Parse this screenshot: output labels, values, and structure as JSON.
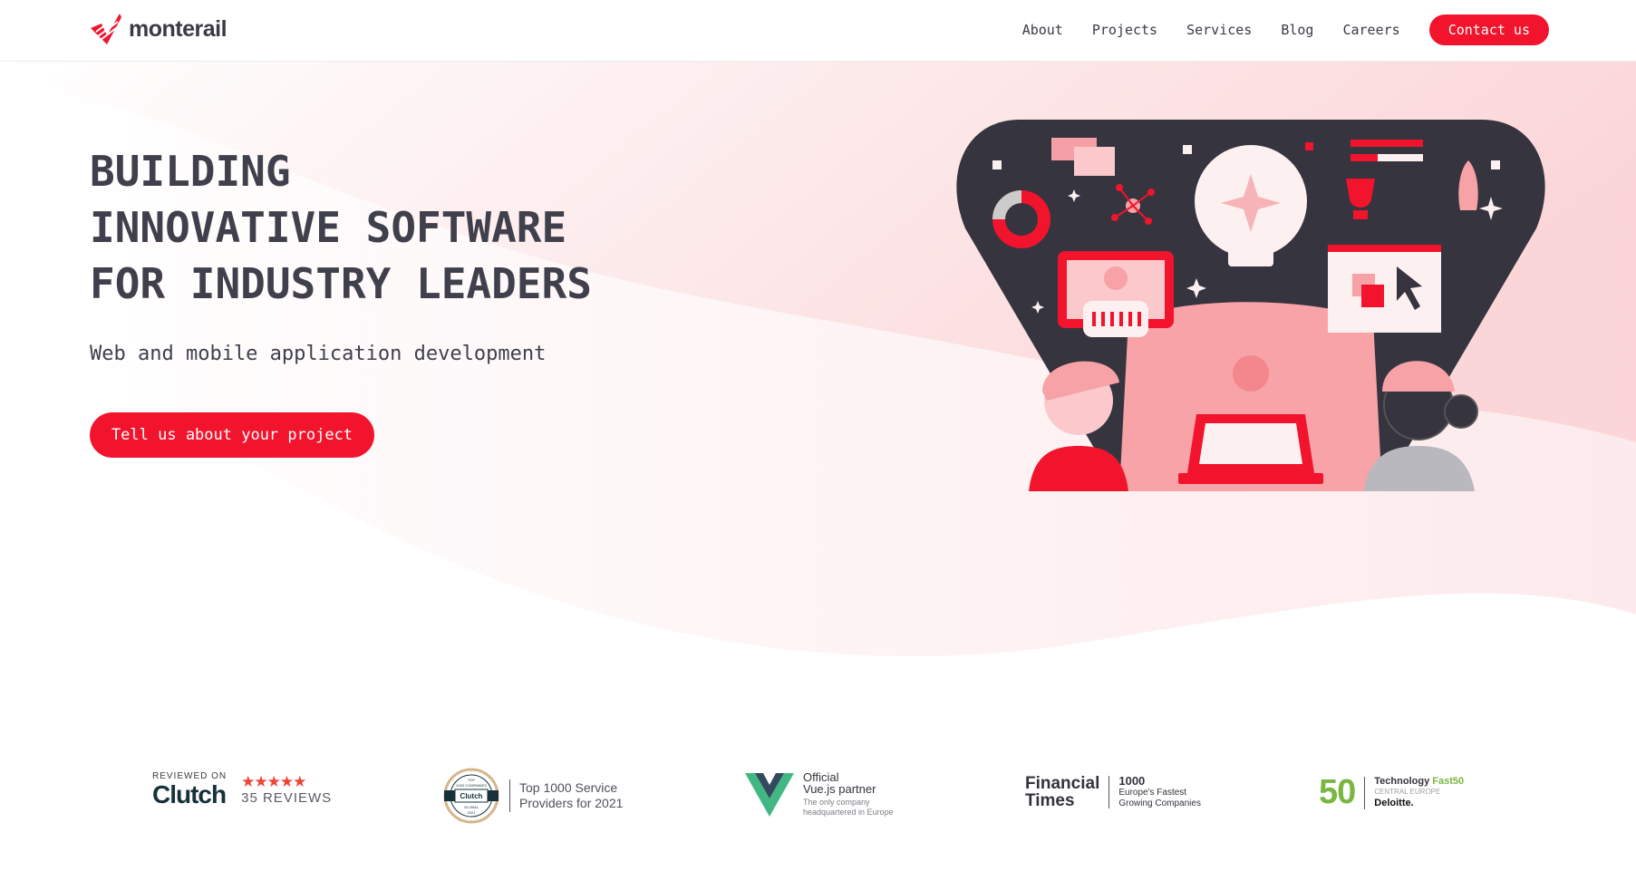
{
  "brand": {
    "name": "monterail",
    "accent": "#f1142c",
    "text_color": "#40404c"
  },
  "nav": {
    "links": [
      "About",
      "Projects",
      "Services",
      "Blog",
      "Careers"
    ],
    "contact_label": "Contact us"
  },
  "hero": {
    "title_lines": [
      "BUILDING",
      "INNOVATIVE SOFTWARE",
      "FOR INDUSTRY LEADERS"
    ],
    "subtitle": "Web and mobile application development",
    "cta_label": "Tell us about your project",
    "illustration": "team-building-software-illustration"
  },
  "badges": {
    "clutch": {
      "reviewed_on": "REVIEWED ON",
      "name": "Clutch",
      "rating_stars": 5,
      "reviews": "35 REVIEWS"
    },
    "clutch_top": {
      "seal_top": "TOP",
      "seal_mid": "1000 COMPANIES",
      "seal_brand": "Clutch",
      "seal_region": "GLOBAL",
      "seal_year": "2021",
      "line1": "Top 1000 Service",
      "line2": "Providers for 2021"
    },
    "vue": {
      "line1": "Official",
      "line2": "Vue.js partner",
      "sub1": "The only company",
      "sub2": "headquartered in Europe"
    },
    "ft": {
      "line1": "Financial",
      "line2": "Times",
      "number": "1000",
      "sub1": "Europe's Fastest",
      "sub2": "Growing Companies"
    },
    "deloitte": {
      "number": "50",
      "tech": "Technology",
      "fast": "Fast50",
      "region": "CENTRAL EUROPE",
      "brand": "Deloitte."
    }
  }
}
